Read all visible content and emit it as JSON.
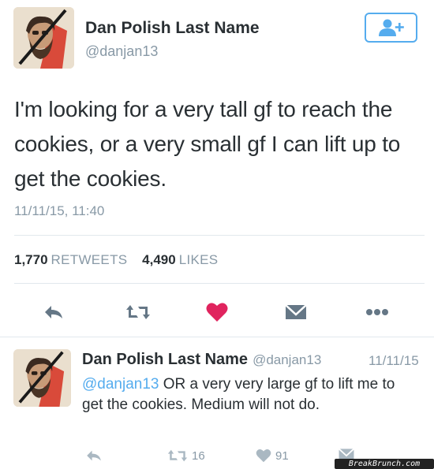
{
  "tweet": {
    "name": "Dan Polish Last Name",
    "handle": "@danjan13",
    "text": "I'm looking for a very tall gf to reach the cookies, or a very small gf I can lift up to get the cookies.",
    "timestamp": "11/11/15, 11:40",
    "retweets": "1,770",
    "retweets_label": "RETWEETS",
    "likes": "4,490",
    "likes_label": "LIKES"
  },
  "actions": {
    "reply_icon": "reply-icon",
    "retweet_icon": "retweet-icon",
    "like_icon": "heart-icon",
    "dm_icon": "envelope-icon",
    "more_icon": "more-icon"
  },
  "reply": {
    "name": "Dan Polish Last Name",
    "handle": "@danjan13",
    "date": "11/11/15",
    "mention": "@danjan13",
    "text": " OR a very very large gf to lift me to get the cookies. Medium will not do.",
    "retweet_count": "16",
    "like_count": "91"
  },
  "watermark": "BreakBrunch.com",
  "colors": {
    "accent": "#55acee",
    "like": "#e0245e",
    "muted": "#8899a6",
    "icon": "#aab8c2"
  }
}
